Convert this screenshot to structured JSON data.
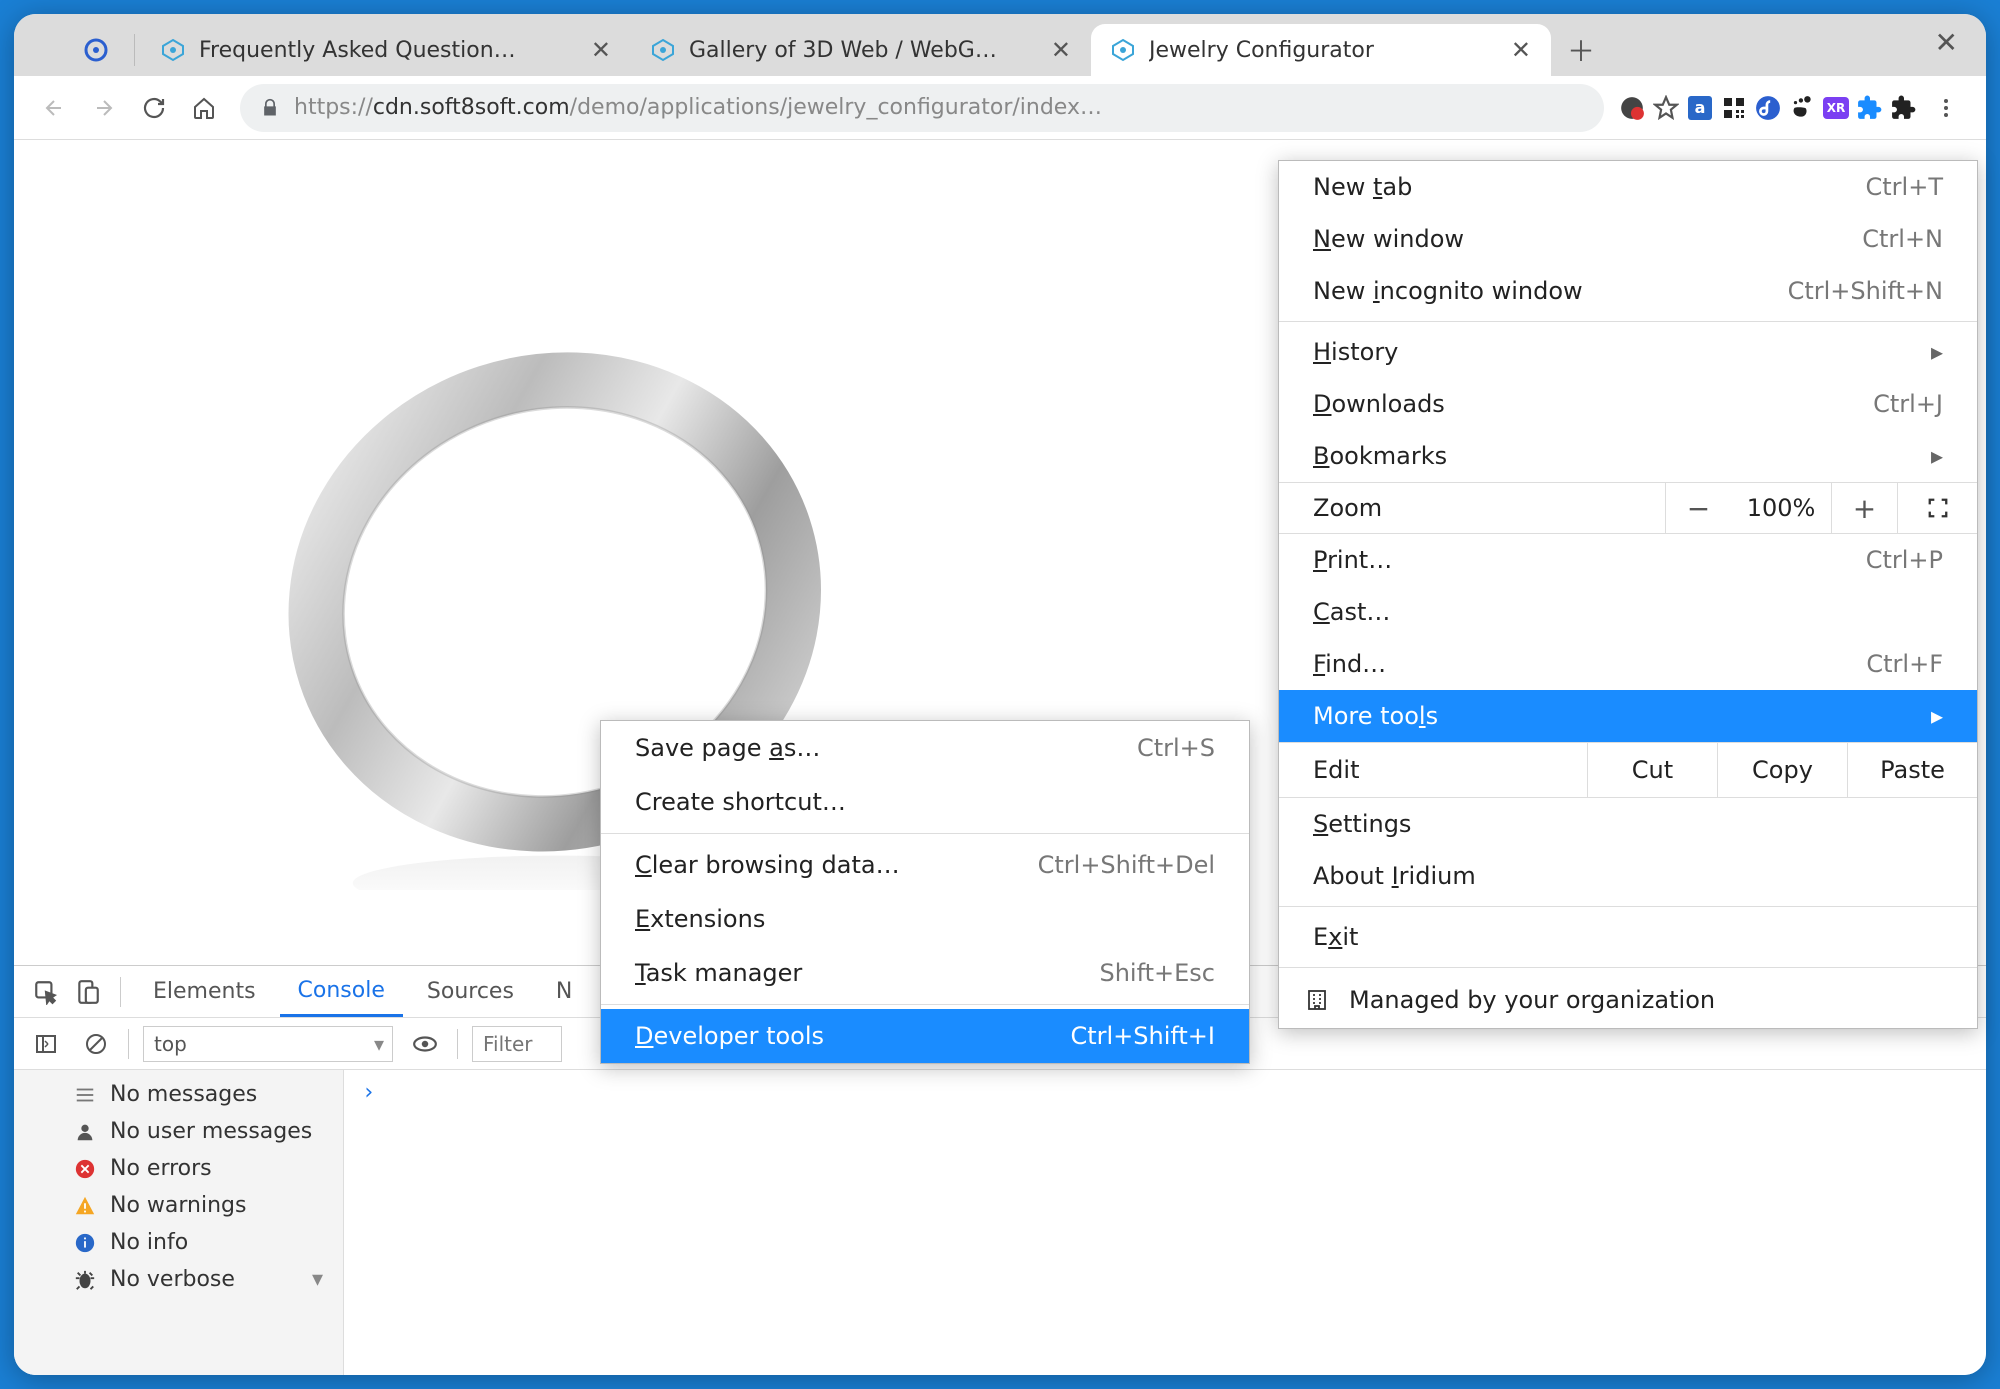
{
  "tabs": [
    {
      "title": "Frequently Asked Question…",
      "active": false
    },
    {
      "title": "Gallery of 3D Web / WebG…",
      "active": false
    },
    {
      "title": "Jewelry Configurator",
      "active": true
    }
  ],
  "url": {
    "scheme": "https://",
    "host": "cdn.soft8soft.com",
    "path": "/demo/applications/jewelry_configurator/index…"
  },
  "extensions": [
    "pie-icon",
    "star-icon",
    "amazon-icon",
    "qr-icon",
    "fedora-icon",
    "gnome-icon",
    "xr-icon",
    "puzzle-blue-icon",
    "puzzle-black-icon",
    "more-icon"
  ],
  "menu": {
    "newtab": {
      "label": "New tab",
      "shortcut": "Ctrl+T",
      "ul": "t"
    },
    "newwin": {
      "label": "New window",
      "shortcut": "Ctrl+N",
      "ul": "N"
    },
    "incog": {
      "label": "New incognito window",
      "shortcut": "Ctrl+Shift+N",
      "ul": "i"
    },
    "history": {
      "label": "History",
      "ul": "H"
    },
    "downloads": {
      "label": "Downloads",
      "shortcut": "Ctrl+J",
      "ul": "D"
    },
    "bookmarks": {
      "label": "Bookmarks",
      "ul": "B"
    },
    "zoom": {
      "label": "Zoom",
      "value": "100%"
    },
    "print": {
      "label": "Print…",
      "shortcut": "Ctrl+P",
      "ul": "P"
    },
    "cast": {
      "label": "Cast…",
      "ul": "C"
    },
    "find": {
      "label": "Find…",
      "shortcut": "Ctrl+F",
      "ul": "F"
    },
    "more": {
      "label": "More tools",
      "ul": "l"
    },
    "edit": {
      "label": "Edit",
      "cut": "Cut",
      "copy": "Copy",
      "paste": "Paste"
    },
    "settings": {
      "label": "Settings",
      "ul": "S"
    },
    "about": {
      "label": "About Iridium",
      "ul": "I"
    },
    "exit": {
      "label": "Exit",
      "ul": "x"
    },
    "managed": "Managed by your organization"
  },
  "submenu": {
    "save": {
      "label": "Save page as…",
      "shortcut": "Ctrl+S",
      "ul": "a"
    },
    "shortcut": {
      "label": "Create shortcut…"
    },
    "clear": {
      "label": "Clear browsing data…",
      "shortcut": "Ctrl+Shift+Del",
      "ul": "C"
    },
    "ext": {
      "label": "Extensions",
      "ul": "E"
    },
    "task": {
      "label": "Task manager",
      "shortcut": "Shift+Esc",
      "ul": "T"
    },
    "dev": {
      "label": "Developer tools",
      "shortcut": "Ctrl+Shift+I",
      "ul": "D"
    }
  },
  "devtools": {
    "tabs": [
      "Elements",
      "Console",
      "Sources",
      "N"
    ],
    "active": "Console",
    "context": "top",
    "filter_placeholder": "Filter",
    "sidebar": [
      {
        "icon": "menu",
        "label": "No messages"
      },
      {
        "icon": "user",
        "label": "No user messages"
      },
      {
        "icon": "error",
        "label": "No errors"
      },
      {
        "icon": "warn",
        "label": "No warnings"
      },
      {
        "icon": "info",
        "label": "No info"
      },
      {
        "icon": "bug",
        "label": "No verbose"
      }
    ]
  }
}
